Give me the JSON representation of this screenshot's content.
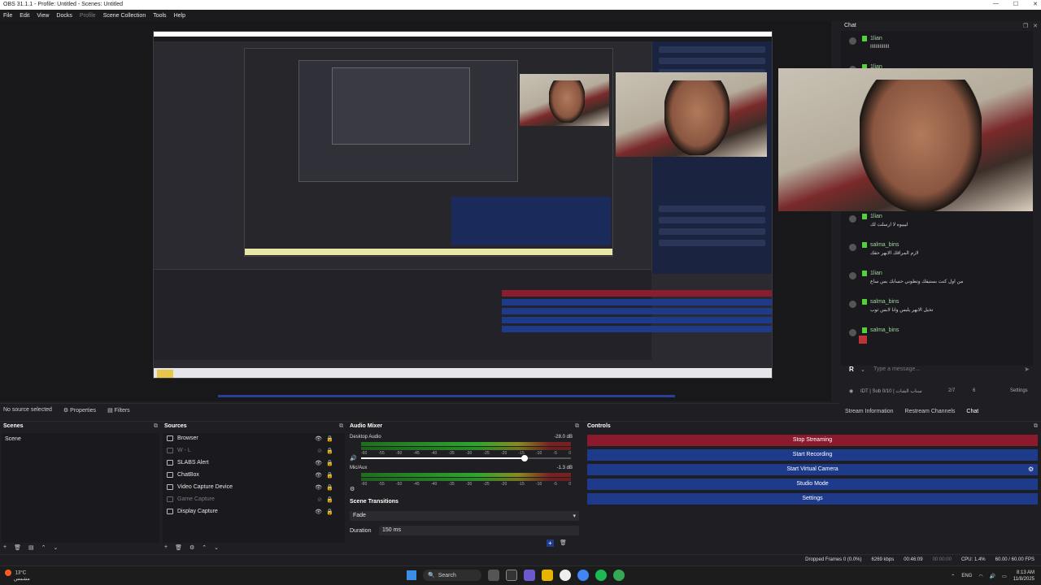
{
  "window": {
    "title": "OBS 31.1.1 - Profile: Untitled - Scenes: Untitled"
  },
  "menu": {
    "items": [
      "File",
      "Edit",
      "View",
      "Docks",
      "Profile",
      "Scene Collection",
      "Tools",
      "Help"
    ]
  },
  "status_row": {
    "no_source": "No source selected",
    "properties": "Properties",
    "filters": "Filters"
  },
  "chat": {
    "title": "Chat",
    "messages": [
      {
        "user": "1lian",
        "text": "ﺍﺍﺍﺍﺍﺍﺍﺍﺍﺍﺍﺍﺍﺍ"
      },
      {
        "user": "1lian",
        "text": ""
      },
      {
        "user": "1lian",
        "text": "ﻟﻴﻴﻴﻮﻩ ﻻ ﺍﺭﺳﻠﺖ ﻟﻚ"
      },
      {
        "user": "salma_bins",
        "text": "ﻻﺯﻡ ﺍﻟﻤﺮﺍﻗﻚ ﺍﻻﺑﻬﺮ ﺣﻘﻚ"
      },
      {
        "user": "1lian",
        "text": "ﻣﻦ ﺍﻭﻝ ﻛﻨﺖ ﺑﺴﺘﻴﻘﻚ ﻭﺗﻄﻮﻧﻲ ﺣﺴﺎﺑﻚ ﺑﺲ ﺳﺎﻉ"
      },
      {
        "user": "salma_bins",
        "text": "ﺗﺨﻴﻞ ﺍﻻﺑﻬﺮ ﻳﻠﺒﺲ ﻭﺍﻧﺎ ﻻﺑﺲ ﺛﻮﺏ"
      },
      {
        "user": "salma_bins",
        "text": ""
      }
    ],
    "input_placeholder": "Type a message...",
    "input_avatar": "R",
    "status_left": "IDT | Sub 0/10 | ﺳﻨﺎﺏ ﺍﻟﺸﺎﺕ",
    "status_count": "2/7",
    "status_views": "6",
    "status_settings": "Settings",
    "tabs": [
      "Stream Information",
      "Restream Channels",
      "Chat"
    ]
  },
  "scenes": {
    "title": "Scenes",
    "items": [
      "Scene"
    ]
  },
  "sources": {
    "title": "Sources",
    "items": [
      {
        "label": "Browser",
        "dim": false
      },
      {
        "label": "W - L",
        "dim": true
      },
      {
        "label": "SLABS Alert",
        "dim": false
      },
      {
        "label": "ChatBox",
        "dim": false
      },
      {
        "label": "Video Capture Device",
        "dim": false
      },
      {
        "label": "Game Capture",
        "dim": true
      },
      {
        "label": "Display Capture",
        "dim": false
      }
    ]
  },
  "mixer": {
    "title": "Audio Mixer",
    "channels": [
      {
        "name": "Desktop Audio",
        "db": "-28.0 dB",
        "level": 0.78
      },
      {
        "name": "Mic/Aux",
        "db": "-1.3 dB",
        "level": 0.0
      }
    ],
    "ticks": [
      "-60",
      "-55",
      "-50",
      "-45",
      "-40",
      "-35",
      "-30",
      "-25",
      "-20",
      "-15",
      "-10",
      "-5",
      "0"
    ]
  },
  "transitions": {
    "title": "Scene Transitions",
    "selected": "Fade",
    "duration_label": "Duration",
    "duration_value": "150 ms"
  },
  "controls": {
    "title": "Controls",
    "stop_streaming": "Stop Streaming",
    "start_recording": "Start Recording",
    "start_virtual_camera": "Start Virtual Camera",
    "studio_mode": "Studio Mode",
    "settings": "Settings"
  },
  "statusbar": {
    "dropped": "Dropped Frames 0 (0.0%)",
    "bitrate": "6269 kbps",
    "stream_time": "00:46:09",
    "rec_time": "00:00:00",
    "cpu": "CPU: 1.4%",
    "fps": "60.00 / 60.00 FPS"
  },
  "taskbar": {
    "weather_temp": "13°C",
    "weather_desc": "مشمس",
    "search": "Search",
    "lang": "ENG",
    "time": "8:13 AM",
    "date": "11/8/2025"
  },
  "colors": {
    "stop": "#8b1a2c",
    "control": "#1e3a8a",
    "twitch_badge": "#53d13b"
  }
}
